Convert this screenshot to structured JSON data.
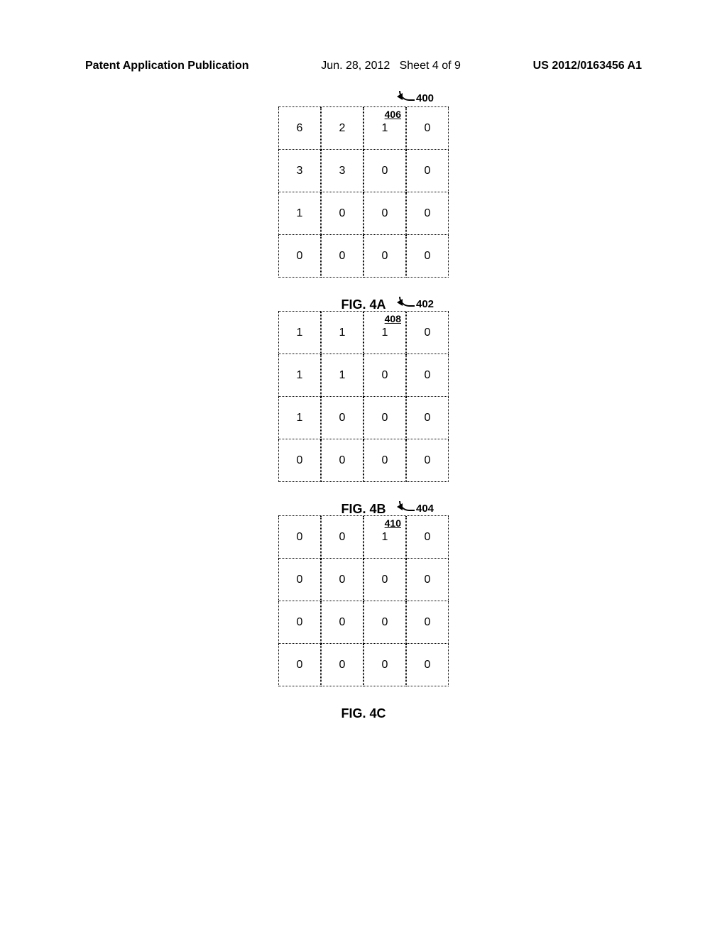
{
  "header": {
    "left": "Patent Application Publication",
    "mid_date": "Jun. 28, 2012",
    "mid_sheet": "Sheet 4 of 9",
    "right": "US 2012/0163456 A1"
  },
  "figures": [
    {
      "callout_num": "400",
      "cell_label_num": "406",
      "caption": "FIG. 4A",
      "rows": [
        [
          "6",
          "2",
          "1",
          "0"
        ],
        [
          "3",
          "3",
          "0",
          "0"
        ],
        [
          "1",
          "0",
          "0",
          "0"
        ],
        [
          "0",
          "0",
          "0",
          "0"
        ]
      ]
    },
    {
      "callout_num": "402",
      "cell_label_num": "408",
      "caption": "FIG. 4B",
      "rows": [
        [
          "1",
          "1",
          "1",
          "0"
        ],
        [
          "1",
          "1",
          "0",
          "0"
        ],
        [
          "1",
          "0",
          "0",
          "0"
        ],
        [
          "0",
          "0",
          "0",
          "0"
        ]
      ]
    },
    {
      "callout_num": "404",
      "cell_label_num": "410",
      "caption": "FIG. 4C",
      "rows": [
        [
          "0",
          "0",
          "1",
          "0"
        ],
        [
          "0",
          "0",
          "0",
          "0"
        ],
        [
          "0",
          "0",
          "0",
          "0"
        ],
        [
          "0",
          "0",
          "0",
          "0"
        ]
      ]
    }
  ]
}
